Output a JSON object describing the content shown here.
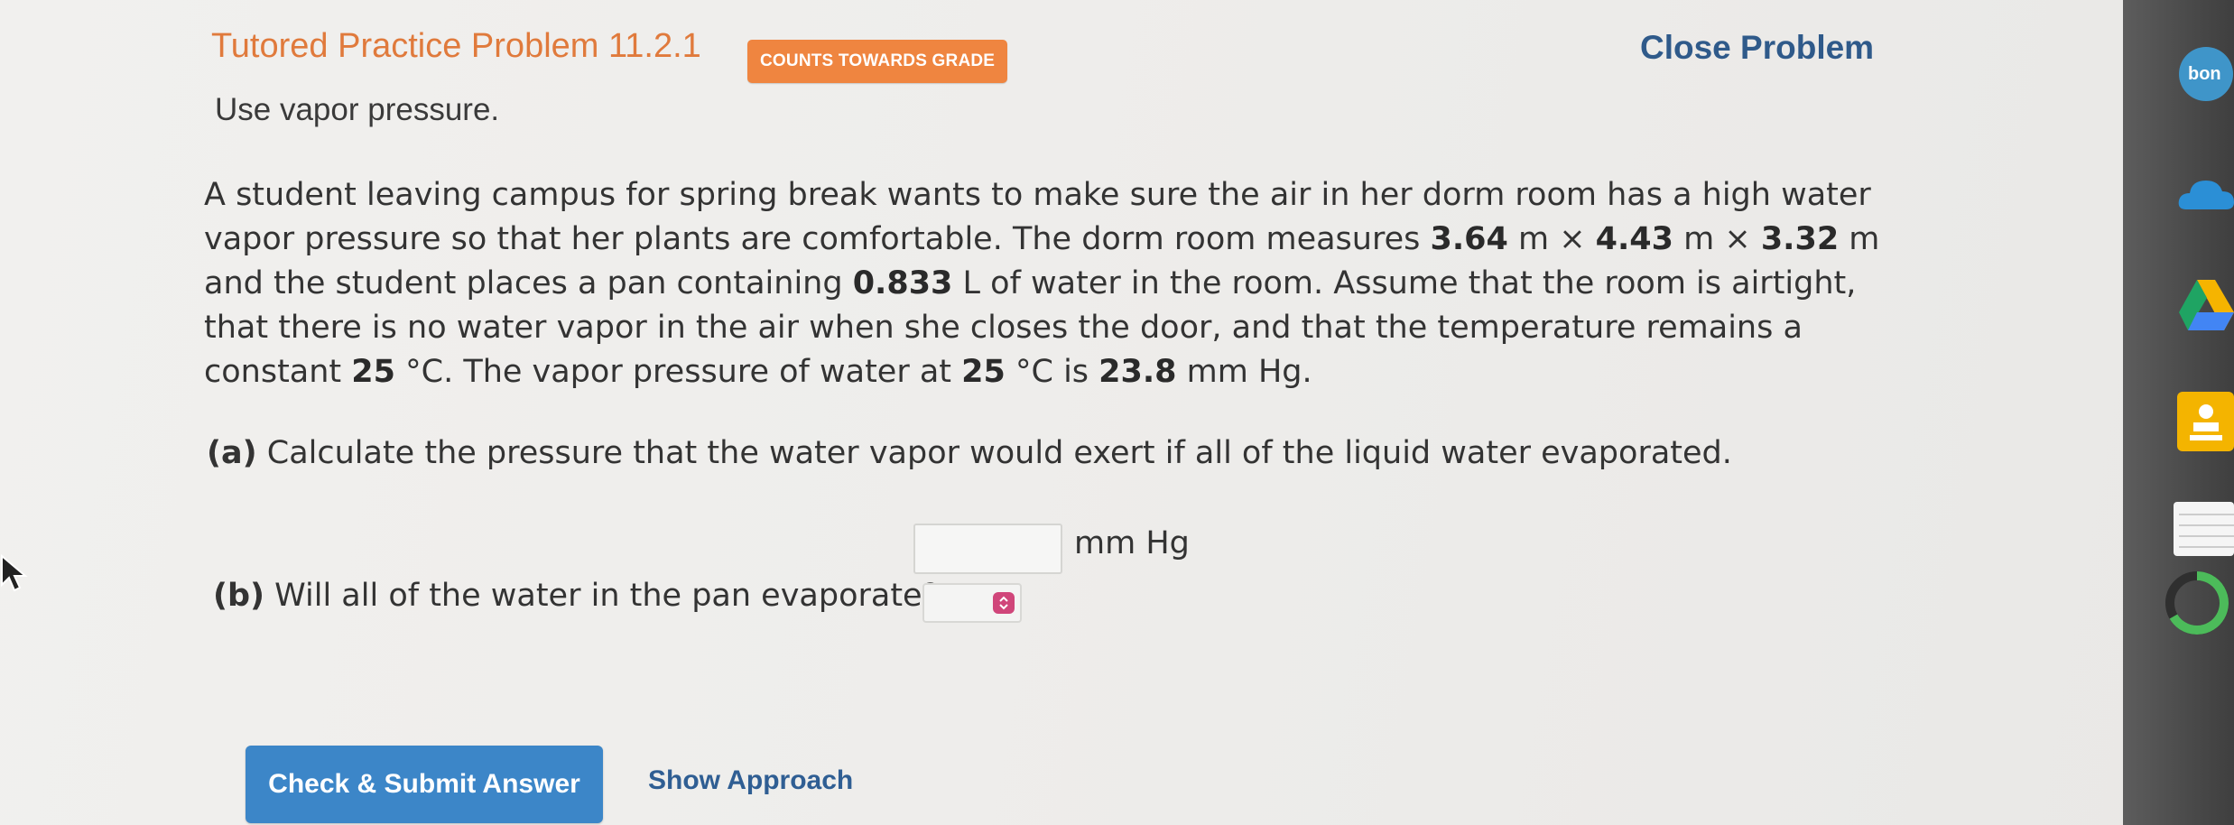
{
  "header": {
    "title": "Tutored Practice Problem 11.2.1",
    "badge": "COUNTS TOWARDS GRADE",
    "close_label": "Close Problem"
  },
  "subtitle": "Use vapor pressure.",
  "problem": {
    "t1": "A student leaving campus for spring break wants to make sure the air in her dorm room has a high water vapor pressure so that her plants are comfortable. The dorm room measures ",
    "dim1": "3.64",
    "t2": " m × ",
    "dim2": "4.43",
    "t3": " m × ",
    "dim3": "3.32",
    "t4": " m and the student places a pan containing ",
    "volume": "0.833",
    "t5": " L of water in the room. Assume that the room is airtight, that there is no water vapor in the air when she closes the door, and that the temperature remains a constant ",
    "temp1": "25",
    "t6": " °C. The vapor pressure of water at ",
    "temp2": "25",
    "t7": " °C is ",
    "vp": "23.8",
    "t8": " mm Hg."
  },
  "part_a": {
    "label": "(a)",
    "text": " Calculate the pressure that the water vapor would exert if all of the liquid water evaporated.",
    "input_value": "",
    "unit": "mm Hg"
  },
  "part_b": {
    "label": "(b)",
    "text": " Will all of the water in the pan evaporate?",
    "selected": ""
  },
  "actions": {
    "submit_label": "Check & Submit Answer",
    "approach_label": "Show Approach"
  },
  "colors": {
    "title": "#e07a3c",
    "badge_bg": "#ef8540",
    "link": "#2f5a8a",
    "button": "#3c86c8",
    "select_arrow": "#d0467a"
  },
  "taskbar": {
    "icons": [
      "bookmark-app-icon",
      "onedrive-icon",
      "google-drive-icon",
      "classroom-icon",
      "notes-icon",
      "progress-ring-icon"
    ],
    "first_icon_text": "bon"
  }
}
